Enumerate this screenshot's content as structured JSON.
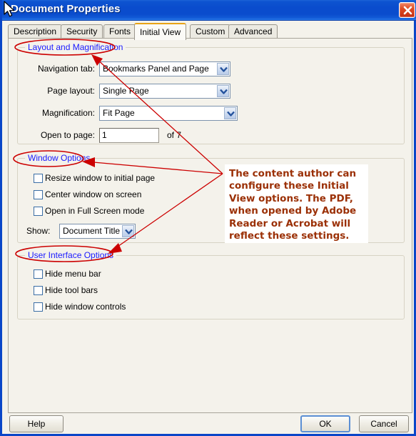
{
  "window": {
    "title": "Document Properties",
    "close_icon": "close-icon"
  },
  "tabs": [
    {
      "label": "Description",
      "active": false
    },
    {
      "label": "Security",
      "active": false
    },
    {
      "label": "Fonts",
      "active": false
    },
    {
      "label": "Initial View",
      "active": true
    },
    {
      "label": "Custom",
      "active": false
    },
    {
      "label": "Advanced",
      "active": false
    }
  ],
  "layout_group": {
    "title": "Layout and Magnification",
    "navigation_tab": {
      "label": "Navigation tab:",
      "value": "Bookmarks Panel and Page"
    },
    "page_layout": {
      "label": "Page layout:",
      "value": "Single Page"
    },
    "magnification": {
      "label": "Magnification:",
      "value": "Fit Page"
    },
    "open_to_page": {
      "label": "Open to page:",
      "value": "1",
      "suffix": "of 7"
    }
  },
  "window_group": {
    "title": "Window Options",
    "checkboxes": [
      {
        "label": "Resize window to initial page",
        "checked": false
      },
      {
        "label": "Center window on screen",
        "checked": false
      },
      {
        "label": "Open in Full Screen mode",
        "checked": false
      }
    ],
    "show": {
      "label": "Show:",
      "value": "Document Title"
    }
  },
  "ui_group": {
    "title": "User Interface Options",
    "checkboxes": [
      {
        "label": "Hide menu bar",
        "checked": false
      },
      {
        "label": "Hide tool bars",
        "checked": false
      },
      {
        "label": "Hide window controls",
        "checked": false
      }
    ]
  },
  "annotation": {
    "text": "The content author can configure these Initial View options.  The PDF, when opened by Adobe Reader or Acrobat will reflect these settings.",
    "color": "#9b3006",
    "callout_color": "#cc0000"
  },
  "footer": {
    "help_label": "Help",
    "ok_label": "OK",
    "cancel_label": "Cancel"
  },
  "colors": {
    "titlebar_blue": "#0a4ccd",
    "dialog_border": "#0a46c8",
    "panel_bg": "#f4f2eb",
    "group_label_blue": "#1a1aff",
    "active_tab_accent": "#e8a317",
    "annotation_red": "#9b3006"
  }
}
